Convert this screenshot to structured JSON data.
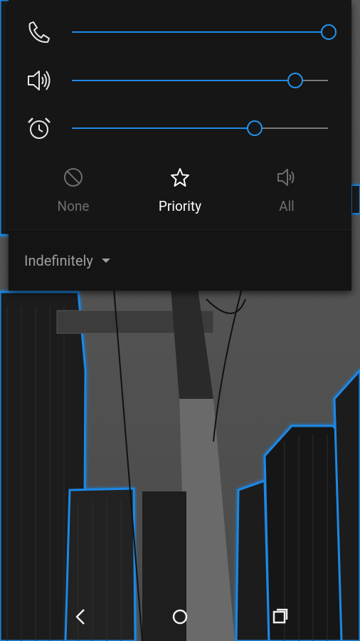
{
  "sliders": [
    {
      "name": "ring-volume",
      "icon": "phone-icon",
      "level": 1.0
    },
    {
      "name": "media-volume",
      "icon": "speaker-icon",
      "level": 0.87
    },
    {
      "name": "alarm-volume",
      "icon": "alarm-clock-icon",
      "level": 0.71
    }
  ],
  "modes": [
    {
      "label": "None",
      "icon": "block-icon",
      "selected": false
    },
    {
      "label": "Priority",
      "icon": "star-icon",
      "selected": true
    },
    {
      "label": "All",
      "icon": "speaker-icon",
      "selected": false
    }
  ],
  "duration": {
    "label": "Indefinitely"
  },
  "navbar": {
    "items": [
      "back-icon",
      "home-icon",
      "recents-icon"
    ]
  },
  "colors": {
    "accent": "#2196f3",
    "panel_bg": "#161616",
    "text_selected": "#ffffff",
    "text_unselected": "#7a7a7a"
  }
}
